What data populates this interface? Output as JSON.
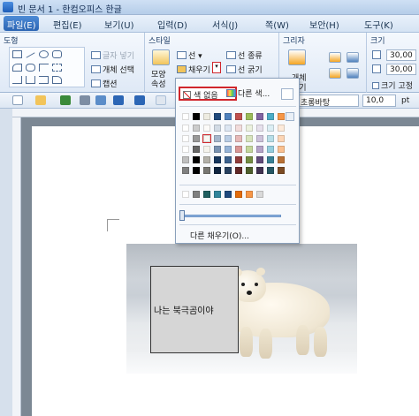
{
  "window": {
    "title": "빈 문서 1 - 한컴오피스 한글"
  },
  "menubar": {
    "items": [
      "파일(E)",
      "편집(E)",
      "보기(U)",
      "입력(D)",
      "서식(J)",
      "쪽(W)",
      "보안(H)",
      "도구(K)"
    ]
  },
  "ribbon": {
    "groups": {
      "shapes": {
        "title": "도형"
      },
      "style": {
        "title": "스타일"
      },
      "grouping": {
        "title": "그리자"
      },
      "size": {
        "title": "크기"
      }
    },
    "shapes": {
      "text_box_label": "글자 넣기",
      "object_select_label": "개체 선택",
      "wrap_label": "캡션"
    },
    "style": {
      "line_label": "선",
      "fill_label": "채우기",
      "line_type_label": "선 종류",
      "line_thickness_label": "선 굵기",
      "shape_props_top": "모양",
      "shape_props_bottom": "속성"
    },
    "grouping": {
      "group_label_top": "개체",
      "group_label_bottom": "묶기"
    },
    "size": {
      "width_value": "30,00",
      "height_value": "30,00",
      "fixed_size_label": "크기 고정"
    }
  },
  "toolbar": {
    "font_value": "초롱바탕",
    "size_value": "10,0",
    "unit": "pt"
  },
  "fill_palette": {
    "no_color_label": "색 없음",
    "other_color_label": "다른 색...",
    "more_fill_label": "다른 채우기(O)...",
    "theme_colors": [
      "#ffffff",
      "#000000",
      "#eeece1",
      "#1f497d",
      "#4f81bd",
      "#c0504d",
      "#9bbb59",
      "#8064a2",
      "#4bacc6",
      "#f79646",
      "#f2f2f2"
    ],
    "recent_colors": [
      "#ffffff",
      "#7f7f7f",
      "#1f5f5f",
      "#31859b",
      "#1f497d",
      "#e36c09",
      "#f79646",
      "#d9d9d9"
    ]
  },
  "document": {
    "textbox_text": "나는 북극곰이야",
    "textbox_fill": "#d6d6d6"
  },
  "colors": {
    "accent": "#2a64b3",
    "highlight_border": "#d0262c"
  }
}
